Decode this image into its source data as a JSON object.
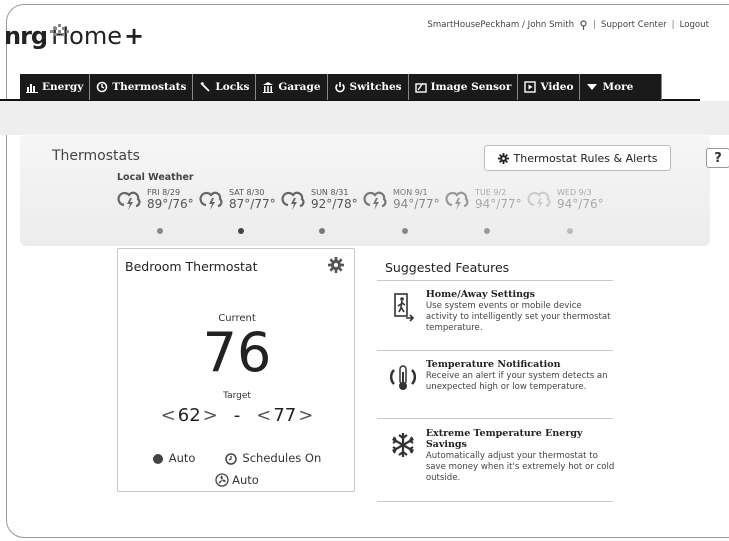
{
  "brand": {
    "nrg": "nrg",
    "home": "Home",
    "plus": "+"
  },
  "toplinks": {
    "account": "SmartHousePeckham / John Smith",
    "separator": "|",
    "support": "Support Center",
    "logout": "Logout"
  },
  "nav": {
    "items": [
      {
        "label": "Energy",
        "icon": "energy-icon"
      },
      {
        "label": "Thermostats",
        "icon": "thermostat-icon"
      },
      {
        "label": "Locks",
        "icon": "key-icon"
      },
      {
        "label": "Garage",
        "icon": "garage-icon"
      },
      {
        "label": "Switches",
        "icon": "power-icon"
      },
      {
        "label": "Image Sensor",
        "icon": "camera-icon"
      },
      {
        "label": "Video",
        "icon": "video-icon"
      },
      {
        "label": "More",
        "icon": "caret-down-icon"
      }
    ]
  },
  "page": {
    "title": "Thermostats",
    "rules_button": "Thermostat Rules & Alerts",
    "help": "?"
  },
  "weather": {
    "label": "Local Weather",
    "days": [
      {
        "date": "FRI 8/29",
        "temps": "89°/76°",
        "icon": "thunderstorm-icon"
      },
      {
        "date": "SAT 8/30",
        "temps": "87°/77°",
        "icon": "thunderstorm-icon"
      },
      {
        "date": "SUN 8/31",
        "temps": "92°/78°",
        "icon": "thunderstorm-icon"
      },
      {
        "date": "MON 9/1",
        "temps": "94°/77°",
        "icon": "thunderstorm-icon"
      },
      {
        "date": "TUE 9/2",
        "temps": "94°/77°",
        "icon": "thunderstorm-icon"
      },
      {
        "date": "WED 9/3",
        "temps": "94°/76°",
        "icon": "thunderstorm-icon"
      }
    ]
  },
  "thermostat": {
    "name": "Bedroom Thermostat",
    "current_label": "Current",
    "current": "76",
    "target_label": "Target",
    "heat_setpoint": "62",
    "cool_setpoint": "77",
    "dash": "-",
    "left_arrow": "<",
    "right_arrow": ">",
    "mode": "Auto",
    "schedules": "Schedules On",
    "fan": "Auto"
  },
  "suggested": {
    "title": "Suggested Features",
    "features": [
      {
        "title": "Home/Away Settings",
        "desc": "Use system events or mobile device activity to intelligently set your thermostat temperature.",
        "icon": "home-away-icon"
      },
      {
        "title": "Temperature Notification",
        "desc": "Receive an alert if your system detects an unexpected high or low temperature.",
        "icon": "thermometer-icon"
      },
      {
        "title": "Extreme Temperature Energy Savings",
        "desc": "Automatically adjust your thermostat to save money when it's extremely hot or cold outside.",
        "icon": "snowflake-icon"
      }
    ]
  },
  "colors": {
    "nav_bg": "#1a1a1a",
    "panel_bg": "#eeeeee",
    "text": "#333333"
  }
}
